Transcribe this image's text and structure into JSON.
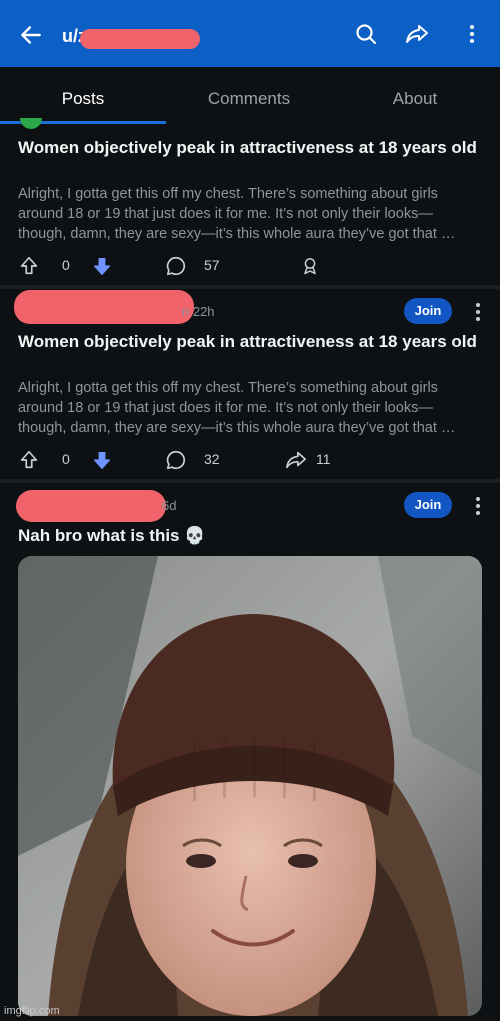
{
  "header": {
    "title": "u/z",
    "back_icon": "arrow-left-icon",
    "search_icon": "search-icon",
    "share_icon": "share-icon",
    "more_icon": "more-vertical-icon"
  },
  "tabs": [
    {
      "label": "Posts",
      "active": true
    },
    {
      "label": "Comments",
      "active": false
    },
    {
      "label": "About",
      "active": false
    }
  ],
  "posts": [
    {
      "title": "Women objectively peak in attractiveness at 18 years old",
      "body": "Alright, I gotta get this off my chest. There’s something about girls around 18 or 19 that just does it for me. It’s not only their looks—though, damn, they are sexy—it’s this whole aura they’ve got that …",
      "votes": "0",
      "comments": "57"
    },
    {
      "meta_time": "n 22h",
      "join_label": "Join",
      "title": "Women objectively peak in attractiveness at 18 years old",
      "body": "Alright, I gotta get this off my chest. There’s something about girls around 18 or 19 that just does it for me. It’s not only their looks—though, damn, they are sexy—it’s this whole aura they’ve got that …",
      "votes": "0",
      "comments": "32",
      "shares": "11"
    },
    {
      "meta_time": "6d",
      "join_label": "Join",
      "title": "Nah bro what is this 💀"
    }
  ],
  "watermark": "imgflip.com",
  "colors": {
    "header_bg": "#0c5fc5",
    "downvote": "#7193ff",
    "join_bg": "#1156c2",
    "redaction": "#f0636b"
  }
}
